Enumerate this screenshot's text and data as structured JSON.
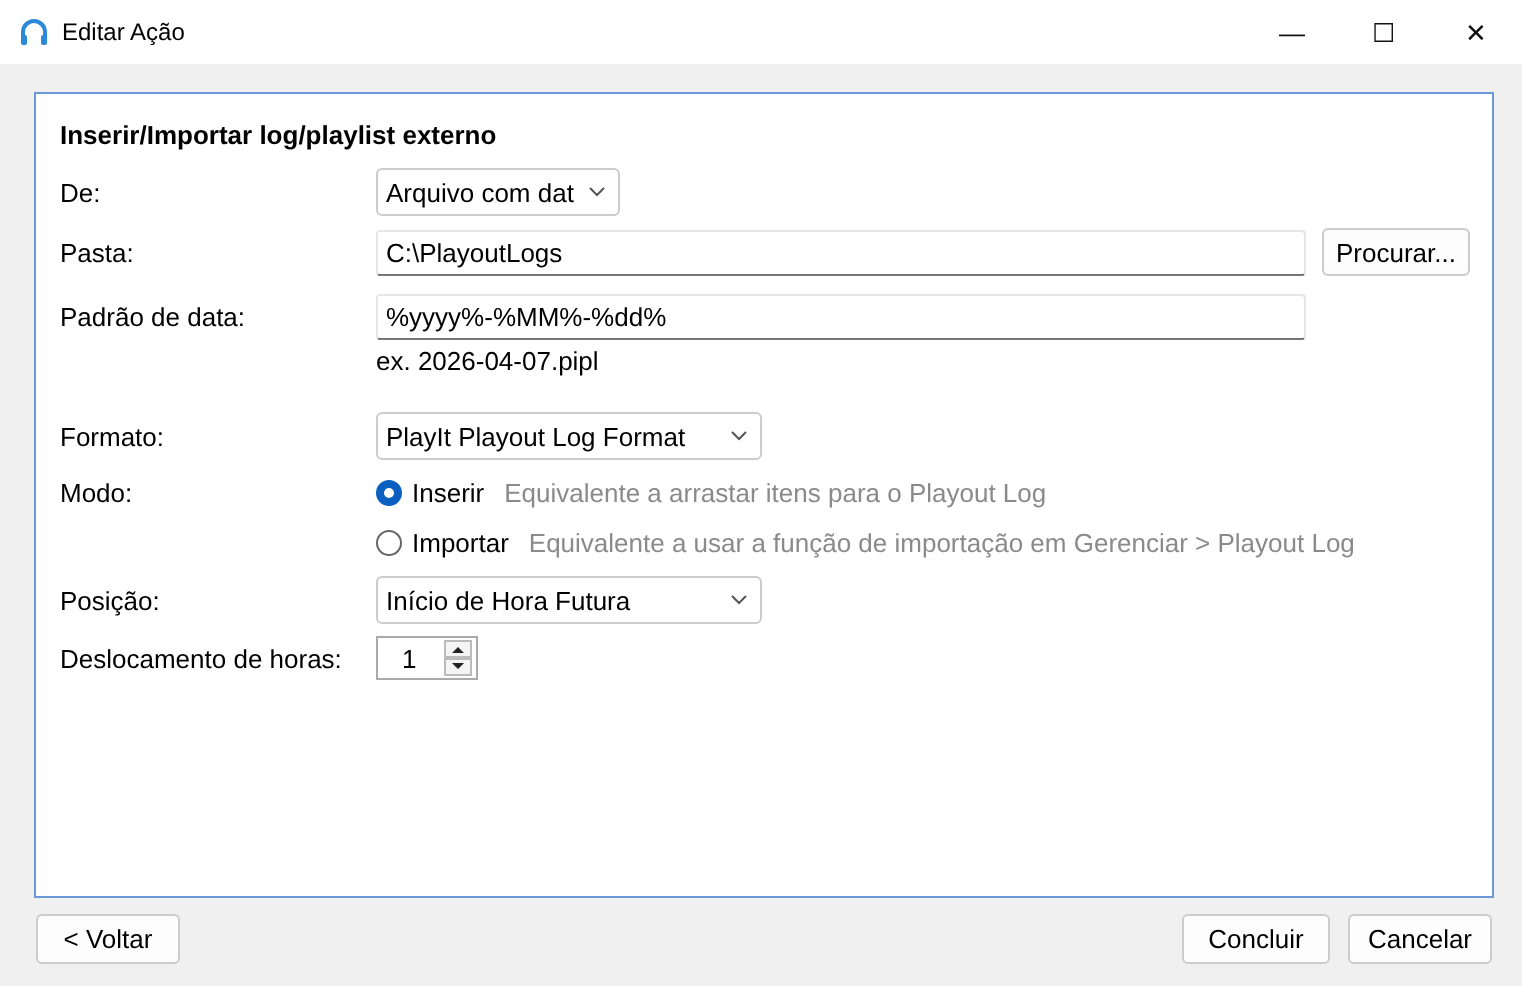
{
  "window": {
    "title": "Editar Ação",
    "controls": [
      "—",
      "☐",
      "✕"
    ]
  },
  "heading": "Inserir/Importar log/playlist externo",
  "source": {
    "label": "De:",
    "value": "Arquivo com dat"
  },
  "folder": {
    "label": "Pasta:",
    "value": "C:\\PlayoutLogs",
    "button": "Procurar..."
  },
  "date_pattern": {
    "label": "Padrão de data:",
    "value": "%yyyy%-%MM%-%dd%",
    "example": "ex. 2026-04-07.pipl"
  },
  "format": {
    "label": "Formato:",
    "value": "PlayIt Playout Log Format"
  },
  "mode": {
    "label": "Modo:",
    "options": [
      {
        "label": "Inserir",
        "hint": "Equivalente a arrastar itens para o Playout Log",
        "selected": true
      },
      {
        "label": "Importar",
        "hint": "Equivalente a usar a função de importação em Gerenciar > Playout Log",
        "selected": false
      }
    ]
  },
  "position": {
    "label": "Posição:",
    "value": "Início de Hora Futura"
  },
  "hour_offset": {
    "label": "Deslocamento de horas:",
    "value": "1"
  },
  "buttons": {
    "back": "< Voltar",
    "finish": "Concluir",
    "cancel": "Cancelar"
  }
}
